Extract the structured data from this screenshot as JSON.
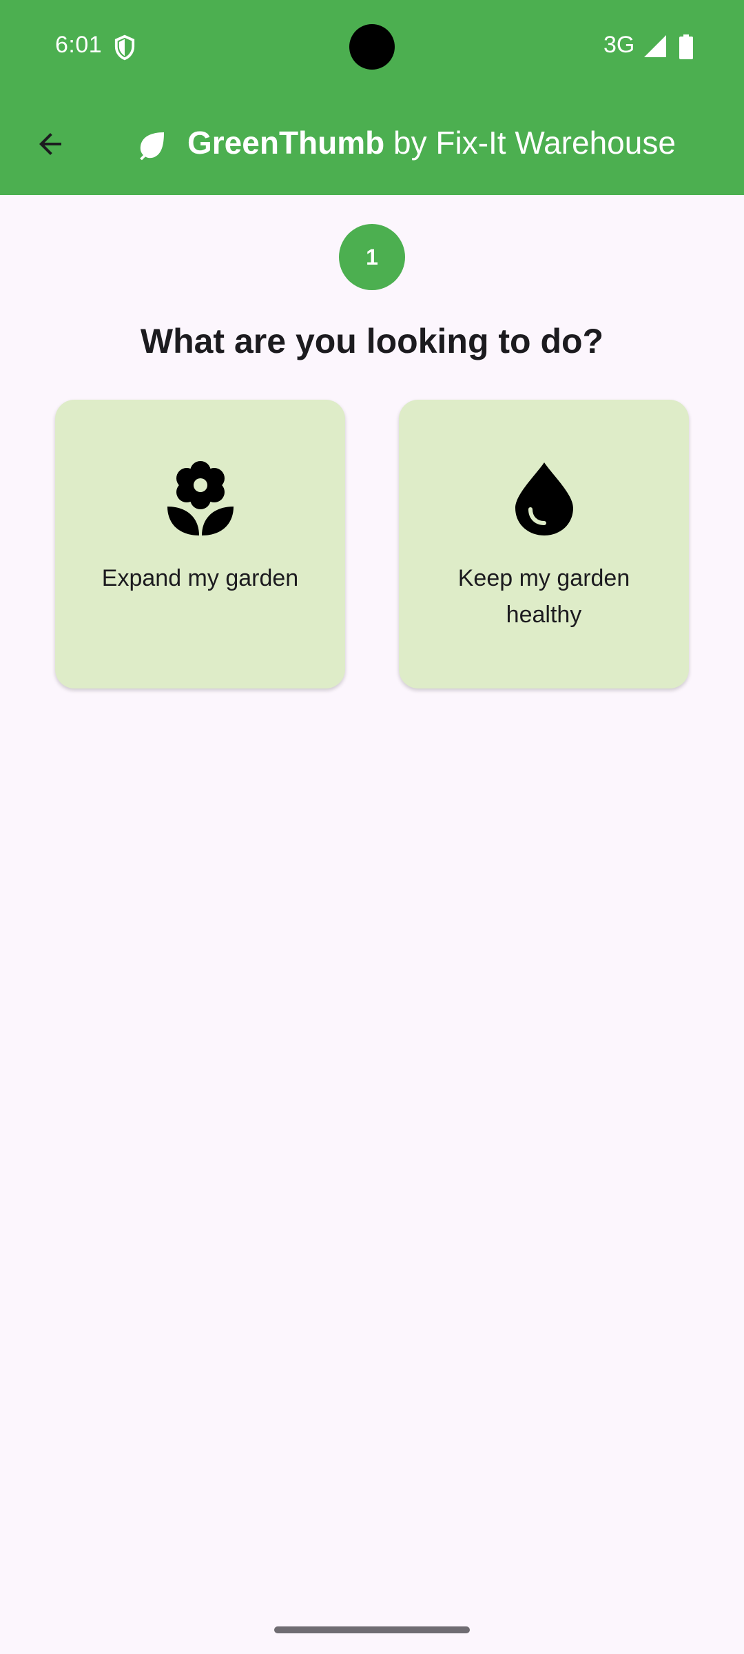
{
  "status_bar": {
    "time": "6:01",
    "network": "3G",
    "icons": [
      "shield-icon",
      "signal-icon",
      "battery-icon"
    ]
  },
  "app_bar": {
    "back_icon": "arrow-back-icon",
    "logo_icon": "leaf-icon",
    "brand": "GreenThumb",
    "by_text": " by Fix-It Warehouse"
  },
  "step": {
    "number": "1"
  },
  "question": "What are you looking to do?",
  "options": [
    {
      "label": "Expand my garden",
      "icon": "flower-icon"
    },
    {
      "label": "Keep my garden healthy",
      "icon": "water-drop-icon"
    }
  ],
  "colors": {
    "primary": "#4caf50",
    "background": "#fcf6fd",
    "card": "#deecc8",
    "text": "#1c1b1f"
  }
}
